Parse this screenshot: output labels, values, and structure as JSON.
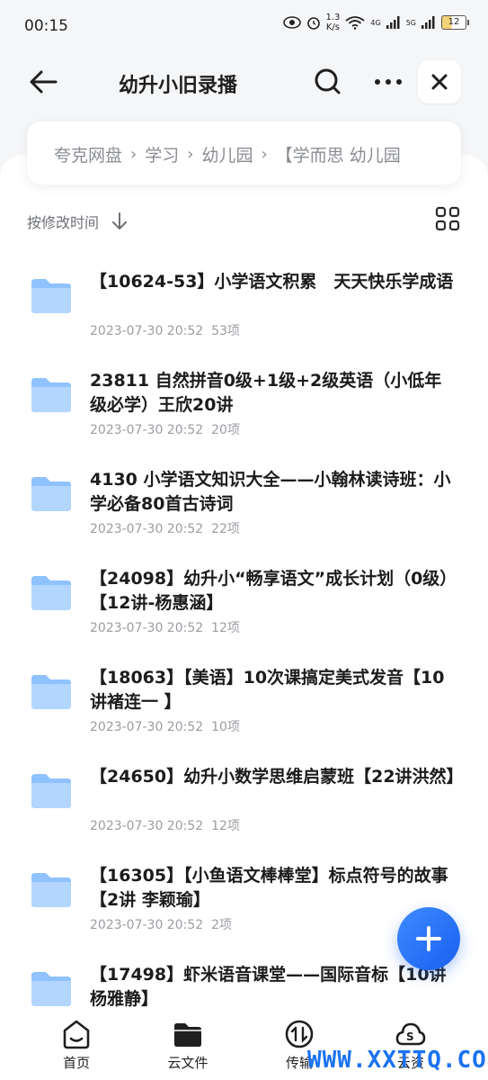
{
  "status_bar": {
    "time": "00:15",
    "speed_value": "1.3",
    "speed_unit": "K/s",
    "net1": "4G",
    "net2": "5G",
    "battery": "12"
  },
  "header": {
    "title": "幼升小旧录播"
  },
  "breadcrumb": [
    "夸克网盘",
    "学习",
    "幼儿园",
    "【学而思 幼儿园"
  ],
  "sort": {
    "label": "按修改时间"
  },
  "files": [
    {
      "name": "【10624-53】小学语文积累　天天快乐学成语",
      "date": "2023-07-30 20:52",
      "count": "53项"
    },
    {
      "name": "23811  自然拼音0级+1级+2级英语（小低年级必学）王欣20讲",
      "date": "2023-07-30 20:52",
      "count": "20项"
    },
    {
      "name": "4130 小学语文知识大全——小翰林读诗班：小学必备80首古诗词",
      "date": "2023-07-30 20:52",
      "count": "22项"
    },
    {
      "name": "【24098】幼升小“畅享语文”成长计划（0级）【12讲-杨惠涵】",
      "date": "2023-07-30 20:52",
      "count": "12项"
    },
    {
      "name": "【18063】【美语】10次课搞定美式发音【10讲褚连一 】",
      "date": "2023-07-30 20:52",
      "count": "10项"
    },
    {
      "name": "【24650】幼升小数学思维启蒙班【22讲洪然】",
      "date": "2023-07-30 20:52",
      "count": "12项"
    },
    {
      "name": "【16305】【小鱼语文棒棒堂】标点符号的故事【2讲 李颖瑜】",
      "date": "2023-07-30 20:52",
      "count": "2项"
    },
    {
      "name": "【17498】虾米语音课堂——国际音标【10讲 杨雅静】",
      "date": "",
      "count": ""
    }
  ],
  "tabs": [
    {
      "label": "首页",
      "icon": "home-icon"
    },
    {
      "label": "云文件",
      "icon": "folder-icon"
    },
    {
      "label": "传输",
      "icon": "transfer-icon"
    },
    {
      "label": "云资",
      "icon": "cloud-icon"
    }
  ],
  "watermark": "WWW.XXTTQ.COM",
  "colors": {
    "accent": "#1a73f0",
    "folder": "#8fc2ff",
    "text_secondary": "#9a9da2"
  }
}
